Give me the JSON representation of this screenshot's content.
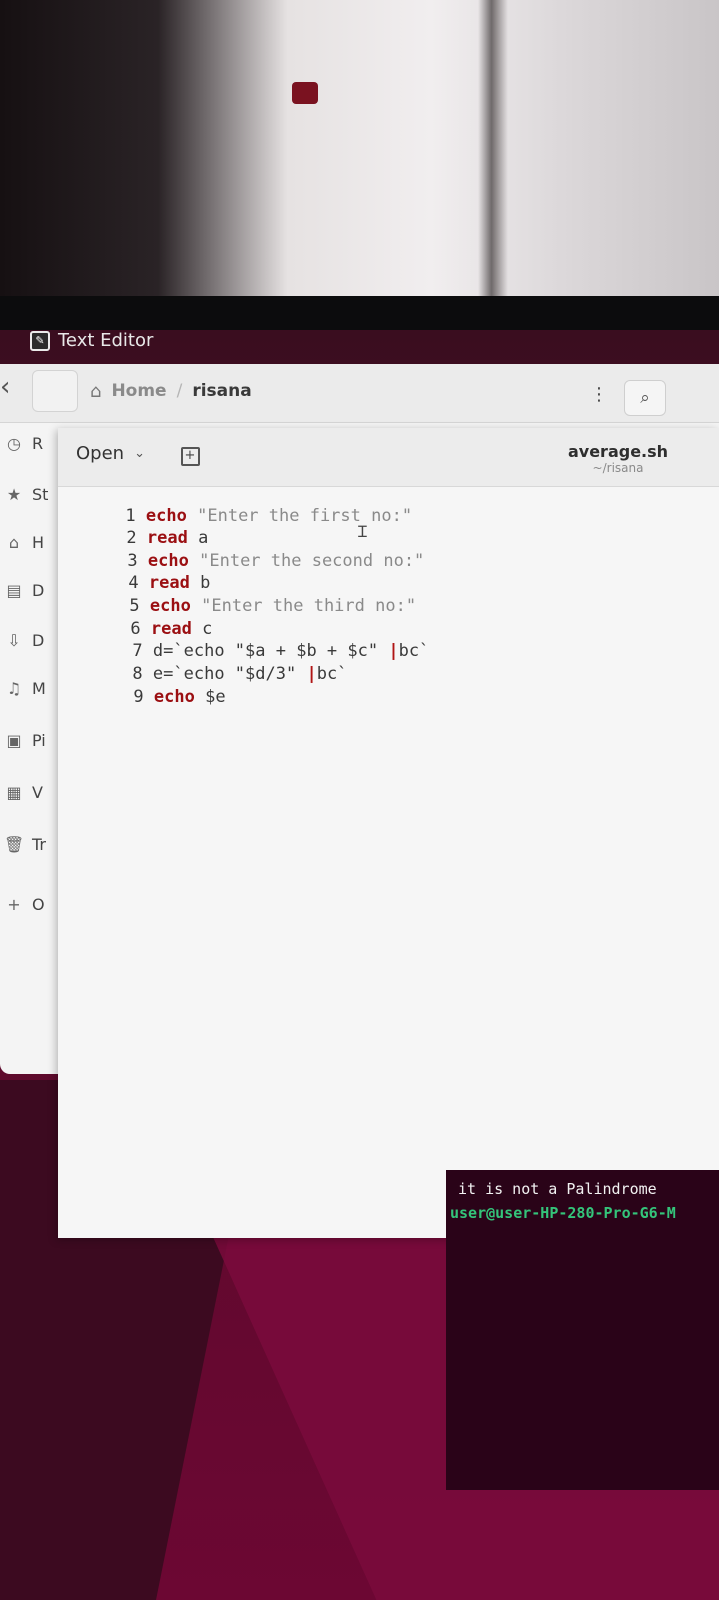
{
  "top_panel": {
    "app_name": "Text Editor"
  },
  "file_manager": {
    "path": {
      "home_label": "Home",
      "separator": "/",
      "folder": "risana"
    },
    "menu_icon_glyph": "⋮",
    "sidebar": [
      {
        "label": "R",
        "icon": "recent-icon",
        "glyph": "◷"
      },
      {
        "label": "St",
        "icon": "star-icon",
        "glyph": "★"
      },
      {
        "label": "H",
        "icon": "home-icon",
        "glyph": "⌂"
      },
      {
        "label": "D",
        "icon": "documents-icon",
        "glyph": "▤"
      },
      {
        "label": "D",
        "icon": "downloads-icon",
        "glyph": "⇩"
      },
      {
        "label": "M",
        "icon": "music-icon",
        "glyph": "♫"
      },
      {
        "label": "Pi",
        "icon": "pictures-icon",
        "glyph": "▣"
      },
      {
        "label": "V",
        "icon": "videos-icon",
        "glyph": "▦"
      },
      {
        "label": "Tr",
        "icon": "trash-icon",
        "glyph": "🗑"
      },
      {
        "label": "O",
        "icon": "plus-icon",
        "glyph": "+"
      }
    ]
  },
  "editor": {
    "open_label": "Open",
    "doc_name": "average.sh",
    "doc_path": "~/risana",
    "lines": [
      {
        "n": "1",
        "kw": "echo",
        "rest": "\"Enter the first no:\""
      },
      {
        "n": "2",
        "kw": "read",
        "rest": "a"
      },
      {
        "n": "3",
        "kw": "echo",
        "rest": "\"Enter the second no:\""
      },
      {
        "n": "4",
        "kw": "read",
        "rest": "b"
      },
      {
        "n": "5",
        "kw": "echo",
        "rest": "\"Enter the third no:\""
      },
      {
        "n": "6",
        "kw": "read",
        "rest": "c"
      },
      {
        "n": "7",
        "kw": "",
        "rest": "d=`echo \"$a + $b + $c\" ",
        "pipe": "|",
        "tail": "bc`"
      },
      {
        "n": "8",
        "kw": "",
        "rest": "e=`echo \"$d/3\" ",
        "pipe": "|",
        "tail": "bc`"
      },
      {
        "n": "9",
        "kw": "echo",
        "rest": "$e"
      }
    ]
  },
  "terminal": {
    "output": "it is not a Palindrome",
    "prompt": "user@user-HP-280-Pro-G6-M"
  }
}
